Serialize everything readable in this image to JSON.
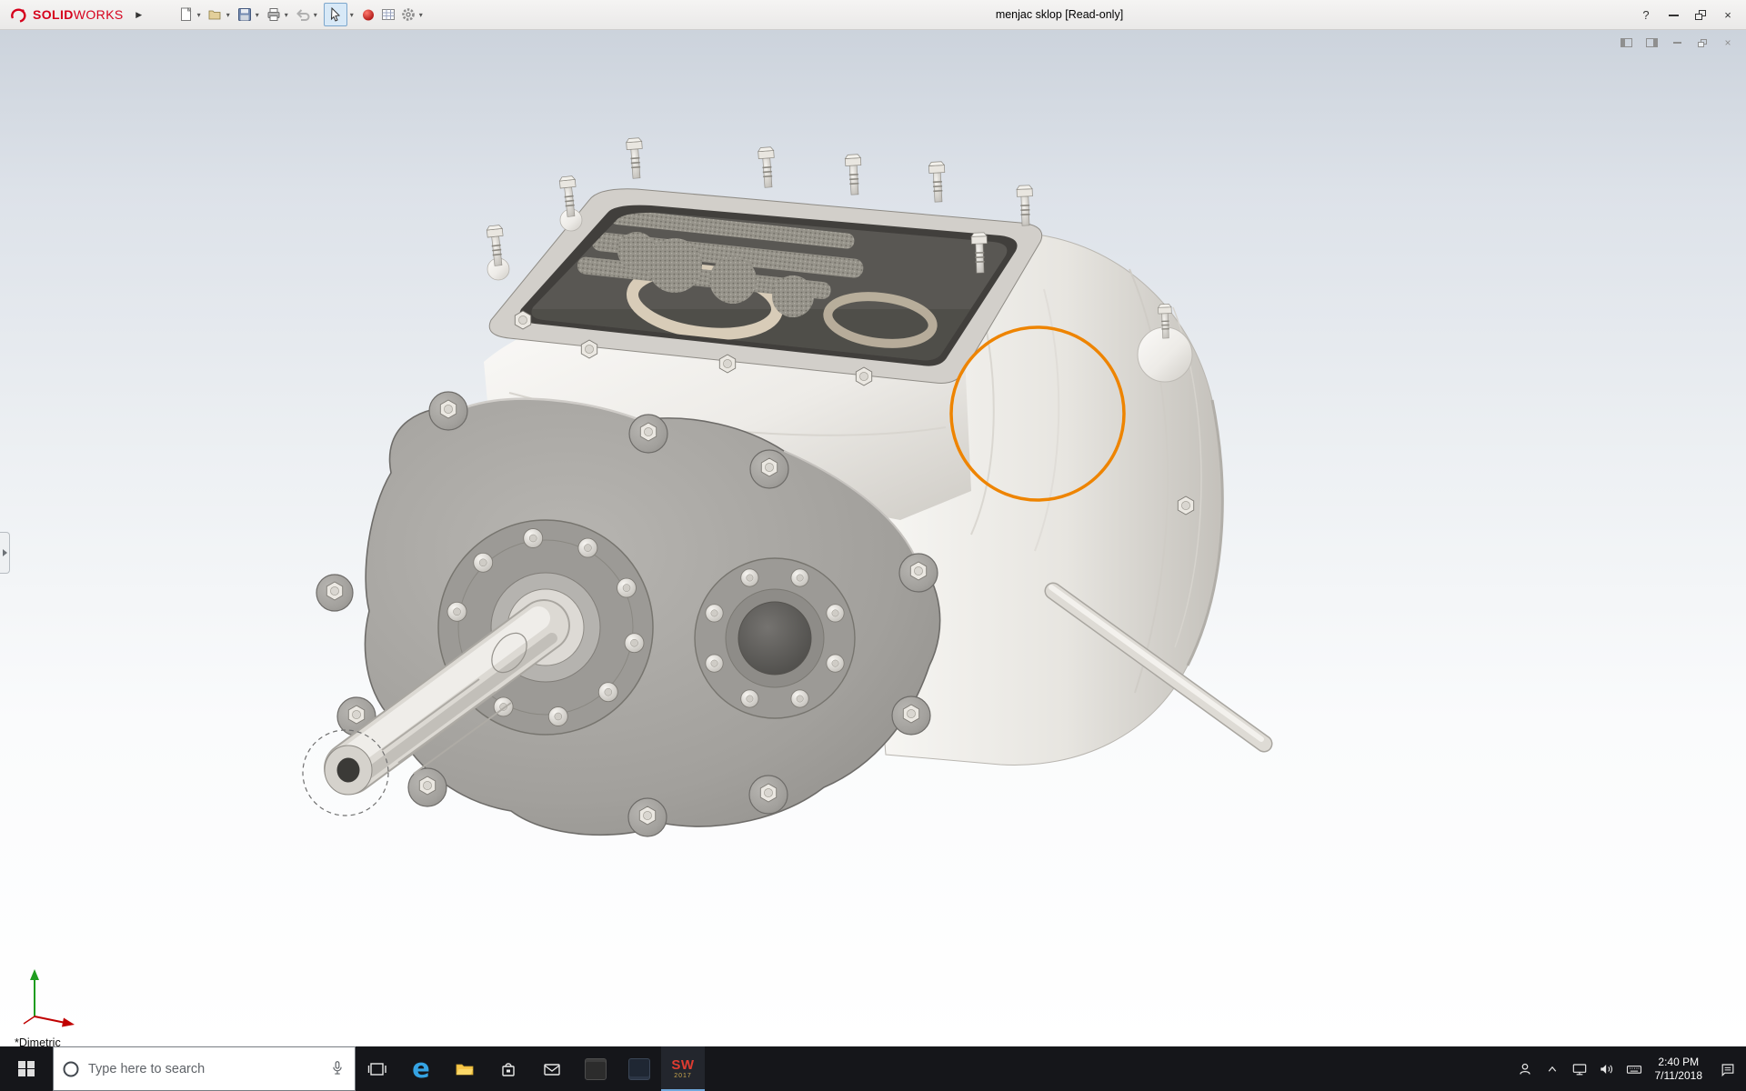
{
  "titlebar": {
    "logo": {
      "solid": "SOLID",
      "works": "WORKS"
    },
    "flyout_glyph": "▶",
    "title": "menjac sklop [Read-only]",
    "help_glyph": "?",
    "close_glyph": "×"
  },
  "toolbar": {
    "dropdown_glyph": "▾",
    "icons": [
      "new-document",
      "open",
      "save",
      "print",
      "undo",
      "select",
      "appearance",
      "design-table",
      "options"
    ]
  },
  "docwindow": {
    "close_glyph": "×"
  },
  "viewport": {
    "orientation_label": "*Dimetric",
    "annotation_color": "#ee8400"
  },
  "taskbar": {
    "search_placeholder": "Type here to search",
    "edge_glyph": "e",
    "solidworks": {
      "label": "SW",
      "year": "2017"
    },
    "clock": {
      "time": "2:40 PM",
      "date": "7/11/2018"
    }
  }
}
